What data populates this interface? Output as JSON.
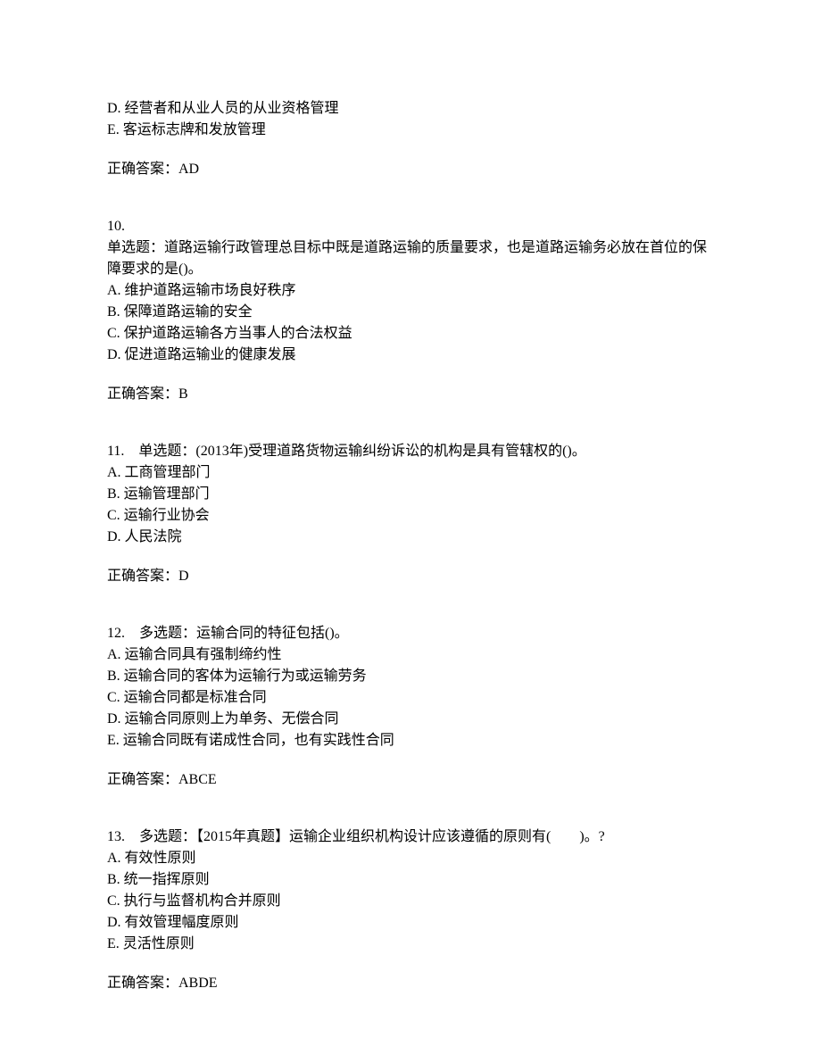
{
  "q9_tail": {
    "options": [
      "D. 经营者和从业人员的从业资格管理",
      "E. 客运标志牌和发放管理"
    ],
    "answer": "正确答案：AD"
  },
  "q10": {
    "number": "10.",
    "stem": "单选题：道路运输行政管理总目标中既是道路运输的质量要求，也是道路运输务必放在首位的保障要求的是()。",
    "options": [
      "A. 维护道路运输市场良好秩序",
      "B. 保障道路运输的安全",
      "C. 保护道路运输各方当事人的合法权益",
      "D. 促进道路运输业的健康发展"
    ],
    "answer": "正确答案：B"
  },
  "q11": {
    "number_stem": "11.　单选题：(2013年)受理道路货物运输纠纷诉讼的机构是具有管辖权的()。",
    "options": [
      "A. 工商管理部门",
      "B. 运输管理部门",
      "C. 运输行业协会",
      "D. 人民法院"
    ],
    "answer": "正确答案：D"
  },
  "q12": {
    "number_stem": "12.　多选题：运输合同的特征包括()。",
    "options": [
      "A. 运输合同具有强制缔约性",
      "B. 运输合同的客体为运输行为或运输劳务",
      "C. 运输合同都是标准合同",
      "D. 运输合同原则上为单务、无偿合同",
      "E. 运输合同既有诺成性合同，也有实践性合同"
    ],
    "answer": "正确答案：ABCE"
  },
  "q13": {
    "number_stem": "13.　多选题：【2015年真题】运输企业组织机构设计应该遵循的原则有(　　)。?",
    "options": [
      "A. 有效性原则",
      "B. 统一指挥原则",
      "C. 执行与监督机构合并原则",
      "D. 有效管理幅度原则",
      "E. 灵活性原则"
    ],
    "answer": "正确答案：ABDE"
  }
}
